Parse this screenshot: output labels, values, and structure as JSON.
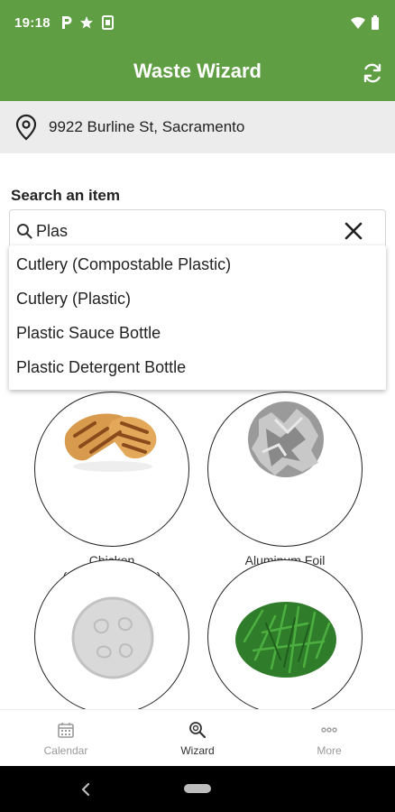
{
  "status_bar": {
    "time": "19:18",
    "icons": [
      "parking-p-icon",
      "star-icon",
      "sim-card-icon",
      "wifi-icon",
      "battery-icon"
    ]
  },
  "app_bar": {
    "title": "Waste Wizard",
    "action_icon": "refresh-icon"
  },
  "address": {
    "icon": "location-pin-icon",
    "text": "9922 Burline St, Sacramento"
  },
  "search": {
    "label": "Search an item",
    "value": "Plas",
    "suggestions": [
      "Cutlery (Compostable Plastic)",
      "Cutlery (Plastic)",
      "Plastic Sauce Bottle",
      "Plastic Detergent Bottle"
    ]
  },
  "items": [
    {
      "name": "Chicken\n(Including Bones)",
      "name_line1": "Chicken",
      "name_line2": "(Including Bones)"
    },
    {
      "name": "Aluminum Foil",
      "name_line1": "Aluminum Foil",
      "name_line2": ""
    },
    {
      "name": "",
      "name_line1": "",
      "name_line2": ""
    },
    {
      "name": "",
      "name_line1": "",
      "name_line2": ""
    }
  ],
  "bottom_nav": [
    {
      "label": "Calendar",
      "icon": "calendar-icon",
      "active": false
    },
    {
      "label": "Wizard",
      "icon": "search-wizard-icon",
      "active": true
    },
    {
      "label": "More",
      "icon": "more-dots-icon",
      "active": false
    }
  ],
  "colors": {
    "brand_green": "#5f9e43",
    "address_bg": "#ececec"
  }
}
